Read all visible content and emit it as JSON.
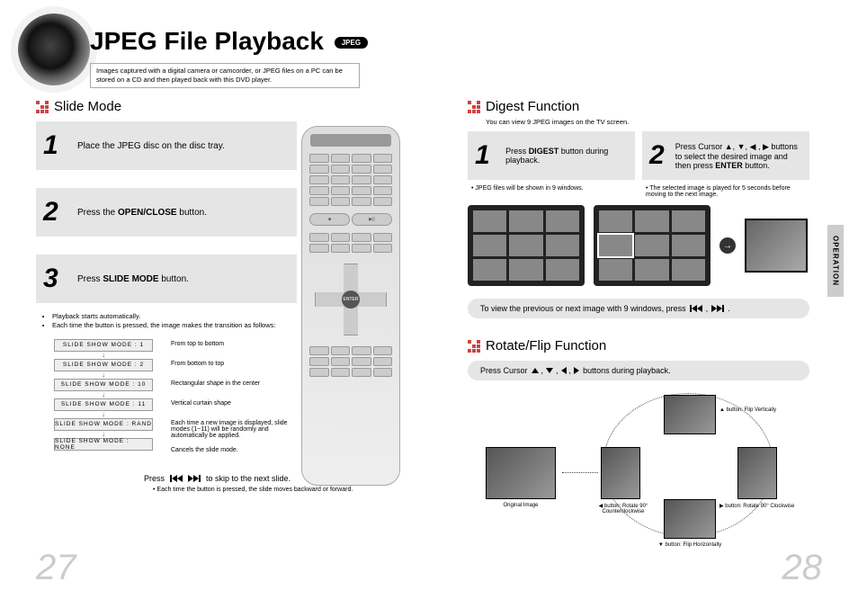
{
  "title": "JPEG File Playback",
  "badge": "JPEG",
  "intro": "Images captured with a digital camera or camcorder, or JPEG files on a PC can be stored on a CD and then played back with this DVD player.",
  "side_tab": "OPERATION",
  "page_left": "27",
  "page_right": "28",
  "slide": {
    "heading": "Slide Mode",
    "steps": [
      {
        "n": "1",
        "text_pre": "Place the JPEG disc on the disc tray.",
        "bold": "",
        "text_post": ""
      },
      {
        "n": "2",
        "text_pre": "Press the ",
        "bold": "OPEN/CLOSE",
        "text_post": " button."
      },
      {
        "n": "3",
        "text_pre": "Press ",
        "bold": "SLIDE MODE",
        "text_post": " button."
      }
    ],
    "notes": [
      "Playback starts automatically.",
      "Each time the button is pressed, the image makes the transition as follows:"
    ],
    "modes": [
      "SLIDE SHOW MODE : 1",
      "SLIDE SHOW MODE : 2",
      "SLIDE SHOW MODE : 10",
      "SLIDE SHOW MODE : 11",
      "SLIDE SHOW MODE : RAND",
      "SLIDE SHOW MODE : NONE"
    ],
    "mode_descs": [
      "From top to bottom",
      "From bottom to top",
      "Rectangular shape in the center",
      "Vertical curtain shape",
      "Each time a new image is displayed, slide modes (1~11) will be randomly and automatically be applied.",
      "Cancels the slide mode."
    ],
    "skip_pre": "Press",
    "skip_post": "to skip to the next slide.",
    "skip_note": "• Each time the button is pressed, the slide moves backward or forward."
  },
  "digest": {
    "heading": "Digest Function",
    "sub": "You can view 9 JPEG images on the TV screen.",
    "steps": [
      {
        "n": "1",
        "html_pre": "Press ",
        "bold": "DIGEST",
        "html_post": " button during playback."
      },
      {
        "n": "2",
        "html_pre": "Press Cursor ▲, ▼, ◀ , ▶ buttons to select the desired image and then press ",
        "bold": "ENTER",
        "html_post": " button."
      }
    ],
    "notes": [
      "JPEG files will be shown in 9 windows.",
      "The selected image is played for 5 seconds before moving to the next image."
    ],
    "round_pre": "To view the previous or next image with 9 windows, press",
    "round_post": "."
  },
  "rotate": {
    "heading": "Rotate/Flip Function",
    "bar_pre": "Press Cursor",
    "bar_post": "buttons during playback.",
    "labels": {
      "original": "Original Image",
      "up": "▲ button: Flip Vertically",
      "left": "◀ button: Rotate 90° Counterclockwise",
      "right": "▶ button: Rotate 90° Clockwise",
      "down": "▼ button: Flip Horizontally"
    }
  },
  "remote": {
    "center": "ENTER"
  }
}
